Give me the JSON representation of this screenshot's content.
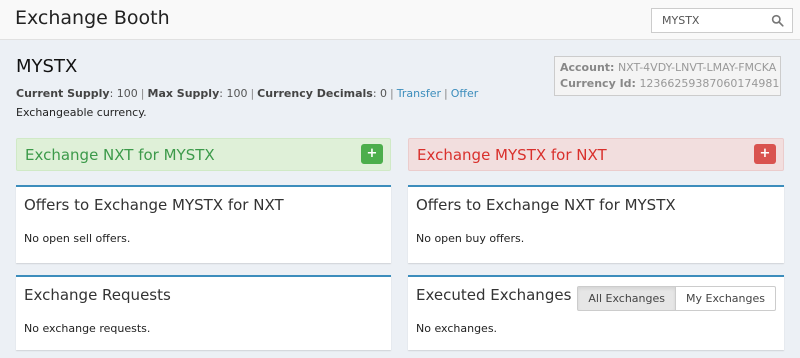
{
  "header": {
    "title": "Exchange Booth",
    "search": {
      "value": "MYSTX",
      "placeholder": "",
      "icon": "search-icon"
    }
  },
  "asset": {
    "name": "MYSTX",
    "current_supply_label": "Current Supply",
    "current_supply": "100",
    "max_supply_label": "Max Supply",
    "max_supply": "100",
    "decimals_label": "Currency Decimals",
    "decimals": "0",
    "transfer_link": "Transfer",
    "offer_link": "Offer",
    "description": "Exchangeable currency."
  },
  "account_box": {
    "account_label": "Account:",
    "account_value": "NXT-4VDY-LNVT-LMAY-FMCKA",
    "currency_id_label": "Currency Id:",
    "currency_id_value": "12366259387060174981"
  },
  "exchange": {
    "buy_label": "Exchange NXT for MYSTX",
    "sell_label": "Exchange MYSTX for NXT",
    "buy_button": "+",
    "sell_button": "+",
    "colors": {
      "buy_bg": "#dff0d8",
      "buy_text": "#3c9a4a",
      "sell_bg": "#f2dede",
      "sell_text": "#d9302c",
      "accent": "#3c8dbc"
    }
  },
  "panels": {
    "sell_offers": {
      "title": "Offers to Exchange MYSTX for NXT",
      "empty": "No open sell offers."
    },
    "buy_offers": {
      "title": "Offers to Exchange NXT for MYSTX",
      "empty": "No open buy offers."
    },
    "requests": {
      "title": "Exchange Requests",
      "empty": "No exchange requests."
    },
    "executed": {
      "title": "Executed Exchanges",
      "empty": "No exchanges.",
      "filter_all": "All Exchanges",
      "filter_mine": "My Exchanges"
    }
  }
}
